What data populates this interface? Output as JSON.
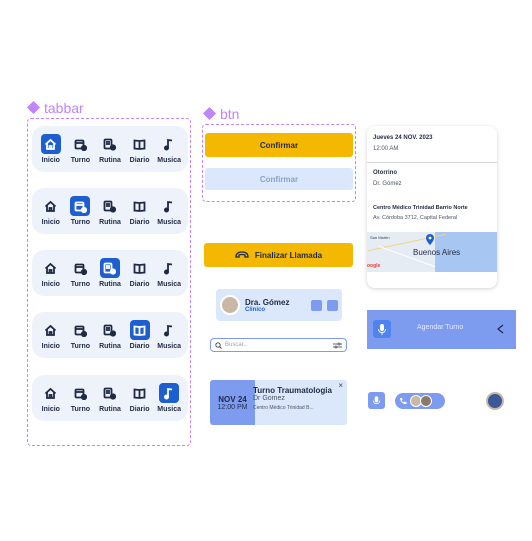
{
  "labels": {
    "tabbar": "tabbar",
    "btn": "btn"
  },
  "tabs": [
    "Inicio",
    "Turno",
    "Rutina",
    "Diario",
    "Musica"
  ],
  "buttons": {
    "confirm_active": "Confirmar",
    "confirm_disabled": "Confirmar",
    "end_call": "Finalizar Llamada"
  },
  "doctor_chip": {
    "name": "Dra. Gómez",
    "role": "Clinico"
  },
  "search": {
    "placeholder": "Buscar.."
  },
  "appointment_card": {
    "month_day": "NOV 24",
    "time": "12:00 PM",
    "title": "Turno Traumatologia",
    "doctor": "Dr Gomez",
    "place": "Centro Médico Trinidad B...",
    "close": "×"
  },
  "detail_card": {
    "date": "Jueves 24 NOV. 2023",
    "time": "12:00 AM",
    "specialty": "Otorrino",
    "doctor": "Dr. Gómez",
    "place": "Centro Médico Trinidad Barrio Norte",
    "address": "Av. Córdoba 3712, Capital Federal",
    "map_city": "Buenos Aires",
    "map_area": "San Martín",
    "map_brand": "oogle"
  },
  "agendar": {
    "label": "Agendar Turno"
  },
  "colors": {
    "primary": "#1d5fd1",
    "yellow": "#f5b800",
    "light_blue": "#dbe7fb",
    "soft_blue": "#7d9cf0",
    "purple": "#c084fc"
  }
}
